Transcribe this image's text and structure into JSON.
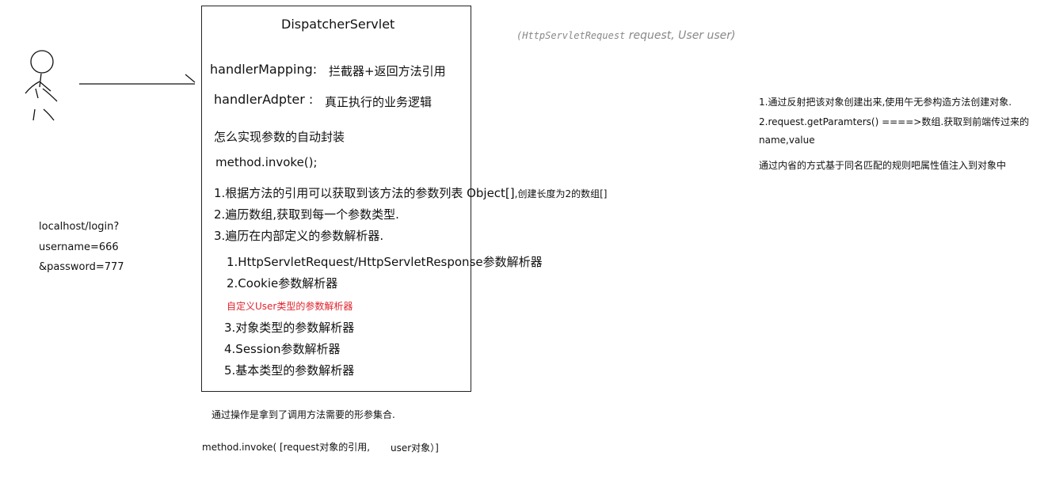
{
  "box": {
    "title": "DispatcherServlet",
    "handler_mapping_label": "handlerMapping:",
    "handler_mapping_desc": "拦截器+返回方法引用",
    "handler_adapter_label": "handlerAdpter :",
    "handler_adapter_desc": "真正执行的业务逻辑",
    "question": "怎么实现参数的自动封装",
    "invoke_call": "method.invoke();",
    "step1_main": "1.根据方法的引用可以获取到该方法的参数列表 Object[]",
    "step1_note": ",创建长度为2的数组[]",
    "step2": "2.遍历数组,获取到每一个参数类型.",
    "step3": "3.遍历在内部定义的参数解析器.",
    "resolvers": [
      "1.HttpServletRequest/HttpServletResponse参数解析器",
      "2.Cookie参数解析器",
      "自定义User类型的参数解析器",
      "3.对象类型的参数解析器",
      "4.Session参数解析器",
      "5.基本类型的参数解析器"
    ]
  },
  "signature": {
    "mono_part": "(HttpServletRequest",
    "rest": " request, User user)"
  },
  "url_note": [
    "localhost/login?",
    "username=666",
    "&password=777"
  ],
  "right_notes": [
    "1.通过反射把该对象创建出来,使用午无参构造方法创建对象.",
    "2.request.getParamters()   ====>数组.获取到前端传过来的",
    "name,value",
    "通过内省的方式基于同名匹配的规则吧属性值注入到对象中"
  ],
  "bottom": {
    "operation_note": "通过操作是拿到了调用方法需要的形参集合.",
    "invoke_left": "method.invoke( [request对象的引用,",
    "invoke_right": "user对象）]"
  },
  "colors": {
    "highlight": "#e0242e",
    "signature": "#888888"
  }
}
